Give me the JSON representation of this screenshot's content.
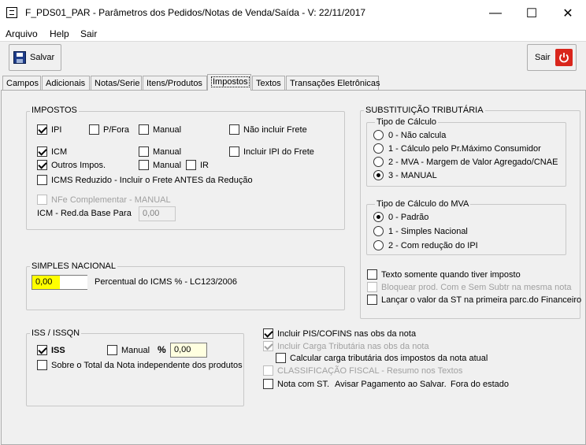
{
  "window": {
    "title": "F_PDS01_PAR - Parâmetros dos Pedidos/Notas de Venda/Saída - V: 22/11/2017",
    "minimize_glyph": "—",
    "maximize_glyph": "☐",
    "close_glyph": "✕"
  },
  "menu": {
    "arquivo": "Arquivo",
    "help": "Help",
    "sair": "Sair"
  },
  "toolbar": {
    "salvar_label": "Salvar",
    "sair_label": "Sair"
  },
  "tabs": {
    "campos": "Campos",
    "adicionais": "Adicionais",
    "notas_serie": "Notas/Serie",
    "itens_produtos": "Itens/Produtos",
    "impostos": "Impostos",
    "textos": "Textos",
    "transacoes": "Transações Eletrônicas"
  },
  "impostos": {
    "title": "IMPOSTOS",
    "ipi": "IPI",
    "pfora": "P/Fora",
    "manual1": "Manual",
    "nao_incluir_frete": "Não incluir Frete",
    "icm": "ICM",
    "manual2": "Manual",
    "incluir_ipi_frete": "Incluir IPI do Frete",
    "outros_impos": "Outros Impos.",
    "manual3": "Manual",
    "ir": "IR",
    "icms_reduzido": "ICMS Reduzido - Incluir o Frete ANTES da Redução",
    "nfe_complementar": "NFe Complementar - MANUAL",
    "icm_red_base_label": "ICM - Red.da Base Para",
    "icm_red_base_value": "0,00"
  },
  "simples": {
    "title": "SIMPLES NACIONAL",
    "value": "0,00",
    "percentual_label": "Percentual do ICMS % - LC123/2006"
  },
  "iss": {
    "title": "ISS / ISSQN",
    "iss": "ISS",
    "manual": "Manual",
    "percent_symbol": "%",
    "percent_value": "0,00",
    "sobre_total": "Sobre o Total da Nota independente dos produtos"
  },
  "st": {
    "title": "SUBSTITUIÇÃO TRIBUTÁRIA",
    "tipo_calculo": {
      "title": "Tipo de Cálculo",
      "options": [
        "0 - Não calcula",
        "1 - Cálculo pelo Pr.Máximo Consumidor",
        "2 - MVA - Margem de Valor Agregado/CNAE",
        "3 - MANUAL"
      ]
    },
    "tipo_calculo_mva": {
      "title": "Tipo de Cálculo do MVA",
      "options": [
        "0 - Padrão",
        "1 - Simples Nacional",
        "2 - Com redução do IPI"
      ]
    },
    "texto_somente": "Texto somente quando tiver imposto",
    "bloquear_prod": "Bloquear prod. Com e Sem Subtr na mesma nota",
    "lancar_valor": "Lançar o valor da ST na primeira parc.do Financeiro"
  },
  "obs": {
    "incluir_pis": "Incluir PIS/COFINS nas obs da nota",
    "incluir_carga": "Incluir Carga Tributária nas obs da nota",
    "calcular_carga": "Calcular carga tributária dos impostos da nota atual",
    "classificacao": "CLASSIFICAÇÃO FISCAL - Resumo nos Textos",
    "nota_com_st": "Nota com ST.",
    "avisar_pagamento": "Avisar Pagamento ao Salvar.",
    "fora_estado": "Fora do estado"
  }
}
